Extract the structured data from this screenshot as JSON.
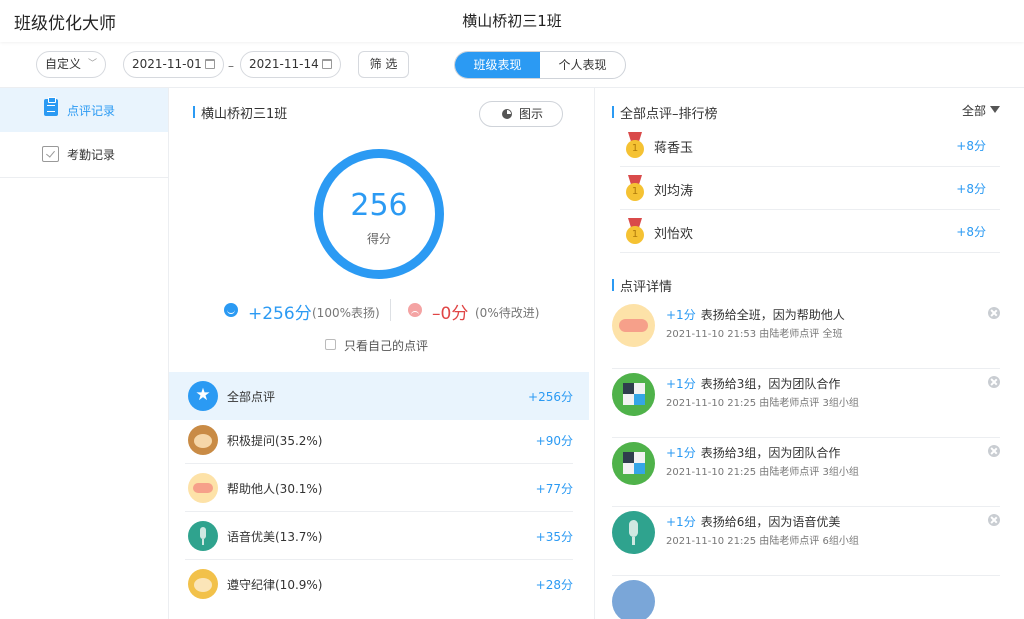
{
  "app": {
    "title": "班级优化大师",
    "class_name": "横山桥初三1班"
  },
  "toolbar": {
    "range_select": "自定义",
    "date_start": "2021-11-01",
    "date_separator": "–",
    "date_end": "2021-11-14",
    "filter_label": "筛 选",
    "tabs": [
      {
        "label": "班级表现",
        "active": true
      },
      {
        "label": "个人表现",
        "active": false
      }
    ]
  },
  "sidebar": {
    "items": [
      {
        "label": "点评记录",
        "icon": "clipboard-icon",
        "active": true
      },
      {
        "label": "考勤记录",
        "icon": "checkbox-icon",
        "active": false
      }
    ]
  },
  "summary": {
    "section_title": "横山桥初三1班",
    "chart_button": "图示",
    "score": "256",
    "score_label": "得分",
    "positive_points": "+256分",
    "positive_note": "(100%表扬)",
    "negative_points": "–0分",
    "negative_note": "(0%待改进)",
    "own_only_label": "只看自己的点评"
  },
  "categories": [
    {
      "name": "全部点评",
      "score": "+256分",
      "icon": "star-icon",
      "active": true
    },
    {
      "name": "积极提问(35.2%)",
      "score": "+90分",
      "icon": "monkey-avatar-icon",
      "active": false
    },
    {
      "name": "帮助他人(30.1%)",
      "score": "+77分",
      "icon": "handshake-icon",
      "active": false
    },
    {
      "name": "语音优美(13.7%)",
      "score": "+35分",
      "icon": "microphone-icon",
      "active": false
    },
    {
      "name": "遵守纪律(10.9%)",
      "score": "+28分",
      "icon": "monkey-avatar-icon",
      "active": false
    }
  ],
  "ranking": {
    "title": "全部点评–排行榜",
    "filter": "全部",
    "rows": [
      {
        "name": "蒋香玉",
        "score": "+8分"
      },
      {
        "name": "刘均涛",
        "score": "+8分"
      },
      {
        "name": "刘怡欢",
        "score": "+8分"
      }
    ]
  },
  "details": {
    "title": "点评详情",
    "rows": [
      {
        "points": "+1分",
        "text": "表扬给全班，因为帮助他人",
        "meta": "2021-11-10 21:53  由陆老师点评 全班",
        "icon": "handshake-icon"
      },
      {
        "points": "+1分",
        "text": "表扬给3组，因为团队合作",
        "meta": "2021-11-10 21:25  由陆老师点评 3组小组",
        "icon": "puzzle-icon"
      },
      {
        "points": "+1分",
        "text": "表扬给3组，因为团队合作",
        "meta": "2021-11-10 21:25  由陆老师点评 3组小组",
        "icon": "puzzle-icon"
      },
      {
        "points": "+1分",
        "text": "表扬给6组，因为语音优美",
        "meta": "2021-11-10 21:25  由陆老师点评 6组小组",
        "icon": "microphone-icon"
      }
    ]
  },
  "colors": {
    "accent": "#2b9af3",
    "negative": "#e04545",
    "active_bg": "#e9f4fd"
  }
}
